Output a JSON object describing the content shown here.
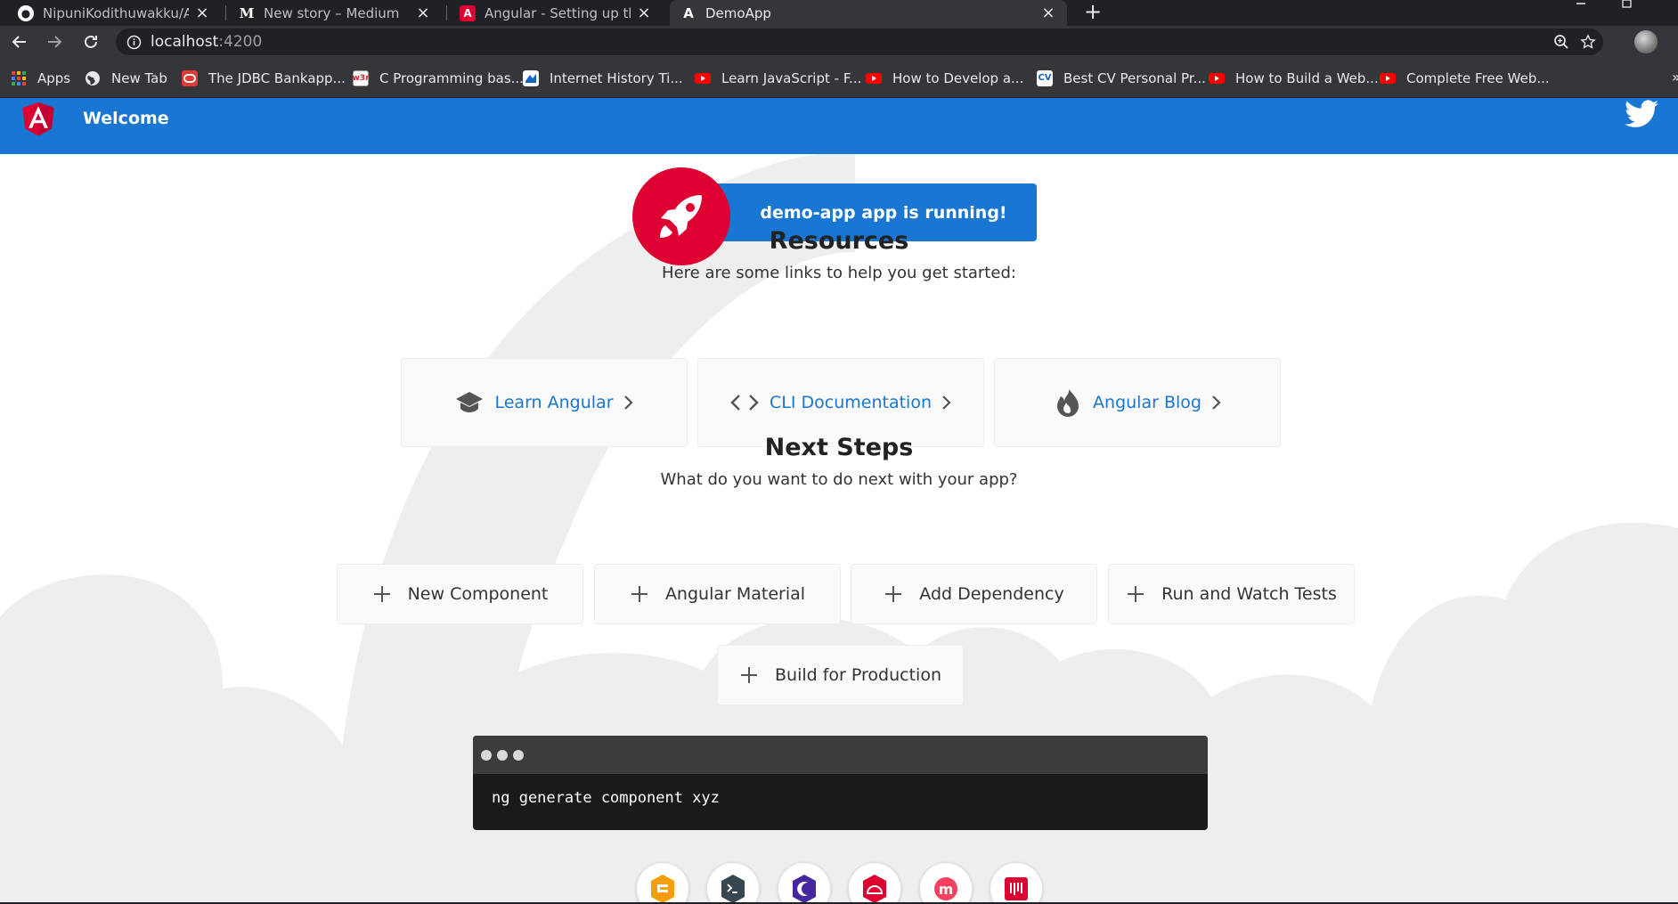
{
  "browser": {
    "tabs": [
      {
        "label": "NipuniKodithuwakku/Angular-fir",
        "icon": "github-icon",
        "active": false
      },
      {
        "label": "New story – Medium",
        "icon": "medium-icon",
        "active": false
      },
      {
        "label": "Angular - Setting up the local en",
        "icon": "angular-icon",
        "active": false
      },
      {
        "label": "DemoApp",
        "icon": "angular-icon",
        "active": true
      }
    ],
    "url_host": "localhost",
    "url_port": ":4200",
    "bookmarks": [
      {
        "label": "Apps",
        "icon": "apps-grid-icon"
      },
      {
        "label": "New Tab",
        "icon": "globe-icon"
      },
      {
        "label": "The JDBC Bankapp...",
        "icon": "oracle-icon"
      },
      {
        "label": "C Programming bas...",
        "icon": "w3schools-icon"
      },
      {
        "label": "Internet History Ti...",
        "icon": "site-icon"
      },
      {
        "label": "Learn JavaScript - F...",
        "icon": "youtube-icon"
      },
      {
        "label": "How to Develop a...",
        "icon": "youtube-icon"
      },
      {
        "label": "Best CV Personal Pr...",
        "icon": "cv-icon"
      },
      {
        "label": "How to Build a Web...",
        "icon": "youtube-icon"
      },
      {
        "label": "Complete Free Web...",
        "icon": "youtube-icon"
      }
    ],
    "bookmark_icon_text": {
      "w3schools": "w3r",
      "cv": "CV"
    },
    "colors": {
      "tab_strip": "#202124",
      "toolbar": "#35363a",
      "youtube": "#ff0000",
      "oracle": "#e53935"
    }
  },
  "app": {
    "toolbar_title": "Welcome",
    "running_text": "demo-app app is running!",
    "resources_title": "Resources",
    "resources_subtitle": "Here are some links to help you get started:",
    "resources": [
      {
        "label": "Learn Angular",
        "icon": "graduation-cap-icon"
      },
      {
        "label": "CLI Documentation",
        "icon": "code-brackets-icon"
      },
      {
        "label": "Angular Blog",
        "icon": "flame-icon"
      }
    ],
    "next_title": "Next Steps",
    "next_subtitle": "What do you want to do next with your app?",
    "next_steps": [
      {
        "label": "New Component"
      },
      {
        "label": "Angular Material"
      },
      {
        "label": "Add Dependency"
      },
      {
        "label": "Run and Watch Tests"
      },
      {
        "label": "Build for Production"
      }
    ],
    "terminal_command": "ng generate component xyz",
    "bottom_links": [
      {
        "icon": "animations-icon"
      },
      {
        "icon": "cli-icon"
      },
      {
        "icon": "augury-icon"
      },
      {
        "icon": "protractor-icon"
      },
      {
        "icon": "meetup-icon"
      },
      {
        "icon": "discord-icon"
      }
    ],
    "colors": {
      "primary": "#1976d2",
      "angular_red": "#dd0031",
      "background_shape": "#eeeeee"
    }
  }
}
